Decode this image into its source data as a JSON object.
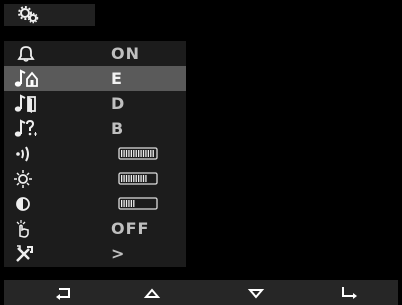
{
  "header": {
    "settings_icon": "gear-pair-icon"
  },
  "menu": {
    "rows": [
      {
        "name": "ringer",
        "icon": "bell-icon",
        "value": "ON",
        "selected": false
      },
      {
        "name": "house-ring-tone",
        "icon": "note-house-icon",
        "value": "E",
        "selected": true
      },
      {
        "name": "door-ring-tone",
        "icon": "note-door-icon",
        "value": "D",
        "selected": false
      },
      {
        "name": "intercom-ring-tone",
        "icon": "note-intercom-icon",
        "value": "B",
        "selected": false
      },
      {
        "name": "volume",
        "icon": "volume-icon",
        "level_pct": 100
      },
      {
        "name": "brightness",
        "icon": "brightness-icon",
        "level_pct": 75
      },
      {
        "name": "contrast",
        "icon": "contrast-icon",
        "level_pct": 40
      },
      {
        "name": "touch-tone",
        "icon": "hand-touch-icon",
        "value": "OFF",
        "selected": false
      },
      {
        "name": "tools",
        "icon": "tools-icon",
        "value": ">",
        "selected": false
      }
    ]
  },
  "footer": {
    "buttons": [
      {
        "name": "back",
        "icon": "back-arrow-icon"
      },
      {
        "name": "up",
        "icon": "up-triangle-icon"
      },
      {
        "name": "down",
        "icon": "down-triangle-icon"
      },
      {
        "name": "enter",
        "icon": "enter-arrow-icon"
      }
    ]
  },
  "colors": {
    "selected_row": "#5a5a5a",
    "panel": "#1c1c1c",
    "text": "#e9e9e9"
  }
}
